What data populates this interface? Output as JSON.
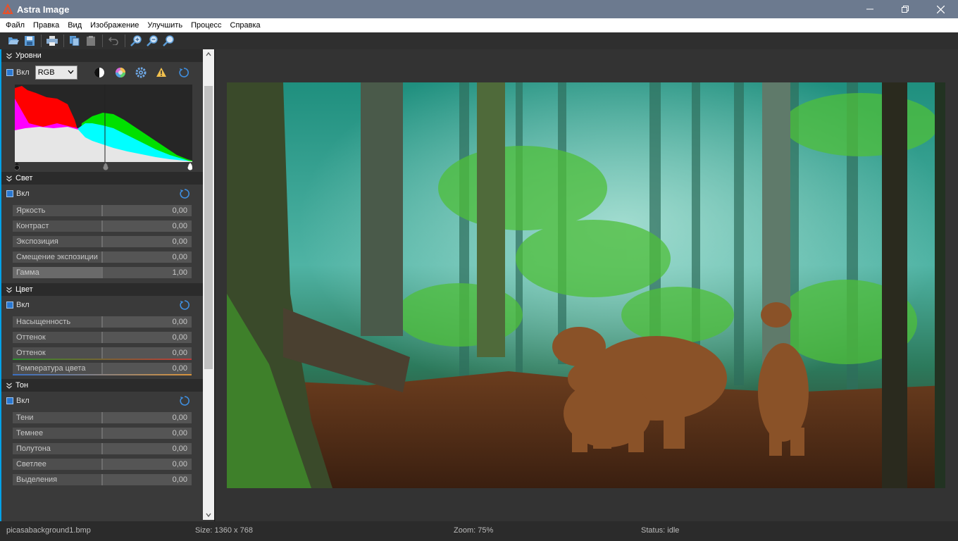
{
  "app": {
    "title": "Astra Image"
  },
  "menu": [
    "Файл",
    "Правка",
    "Вид",
    "Изображение",
    "Улучшить",
    "Процесс",
    "Справка"
  ],
  "toolbar": [
    "open-icon",
    "save-icon",
    "print-icon",
    "copy-icon",
    "paste-icon",
    "undo-icon",
    "zoom-in-icon",
    "zoom-out-icon",
    "zoom-fit-icon"
  ],
  "levels": {
    "title": "Уровни",
    "enable_label": "Вкл",
    "channel": "RGB"
  },
  "light": {
    "title": "Свет",
    "enable_label": "Вкл",
    "sliders": [
      {
        "label": "Яркость",
        "value": "0,00"
      },
      {
        "label": "Контраст",
        "value": "0,00"
      },
      {
        "label": "Экспозиция",
        "value": "0,00"
      },
      {
        "label": "Смещение экспозиции",
        "value": "0,00"
      },
      {
        "label": "Гамма",
        "value": "1,00"
      }
    ]
  },
  "color": {
    "title": "Цвет",
    "enable_label": "Вкл",
    "sliders": [
      {
        "label": "Насыщенность",
        "value": "0,00"
      },
      {
        "label": "Оттенок",
        "value": "0,00"
      },
      {
        "label": "Оттенок",
        "value": "0,00"
      },
      {
        "label": "Температура цвета",
        "value": "0,00"
      }
    ]
  },
  "tone": {
    "title": "Тон",
    "enable_label": "Вкл",
    "sliders": [
      {
        "label": "Тени",
        "value": "0,00"
      },
      {
        "label": "Темнее",
        "value": "0,00"
      },
      {
        "label": "Полутона",
        "value": "0,00"
      },
      {
        "label": "Светлее",
        "value": "0,00"
      },
      {
        "label": "Выделения",
        "value": "0,00"
      }
    ]
  },
  "status": {
    "file": "picasabackground1.bmp",
    "size": "Size: 1360 x 768",
    "zoom": "Zoom: 75%",
    "state": "Status: idle"
  },
  "colors": {
    "accent": "#2a78d1",
    "titlebar": "#6c7a8f",
    "tint_line": "#c23a3a",
    "temp_line_left": "#3a6fc2",
    "temp_line_right": "#d9933a"
  }
}
